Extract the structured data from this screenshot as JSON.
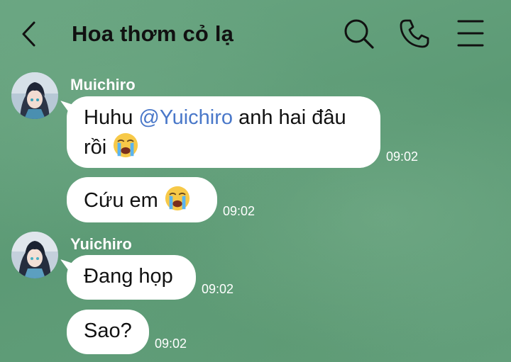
{
  "header": {
    "title": "Hoa thơm cỏ lạ",
    "icons": [
      "chevron-left-icon",
      "search-icon",
      "phone-icon",
      "menu-icon"
    ]
  },
  "messages": [
    {
      "sender": "Muichiro",
      "parts": [
        "Huhu ",
        "@Yuichiro",
        " anh hai đâu",
        "rồi "
      ],
      "emoji": "loudly-crying-face-icon",
      "time": "09:02"
    },
    {
      "text": "Cứu em ",
      "emoji": "loudly-crying-face-icon",
      "time": "09:02"
    },
    {
      "sender": "Yuichiro",
      "text": "Đang họp",
      "time": "09:02"
    },
    {
      "text": "Sao?",
      "time": "09:02"
    }
  ],
  "colors": {
    "background": "#5f9c78",
    "bubble": "#ffffff",
    "mention": "#4a78c9",
    "title": "#111111"
  }
}
